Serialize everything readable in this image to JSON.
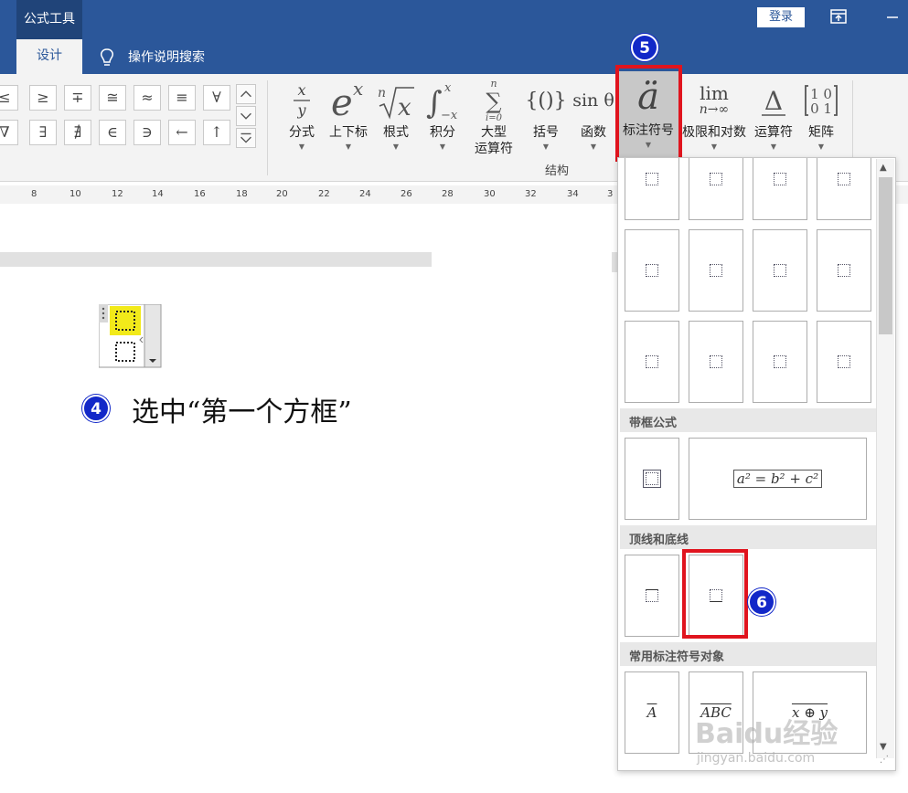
{
  "titlebar": {
    "context_tab": "公式工具",
    "login": "登录",
    "brand_color": "#2b579a"
  },
  "tabs": {
    "design": "设计",
    "search_hint": "操作说明搜索"
  },
  "symbols": {
    "row1": [
      "≤",
      "≥",
      "∓",
      "≅",
      "≈",
      "≡",
      "∀"
    ],
    "row2": [
      "∇",
      "∃",
      "∄",
      "∈",
      "∋",
      "←",
      "↑"
    ]
  },
  "ribbon": {
    "buttons": [
      {
        "label": "分式",
        "icon": "fraction-icon"
      },
      {
        "label": "上下标",
        "icon": "script-icon"
      },
      {
        "label": "根式",
        "icon": "radical-icon"
      },
      {
        "label": "积分",
        "icon": "integral-icon"
      },
      {
        "label": "大型\n运算符",
        "icon": "large-operator-icon"
      },
      {
        "label": "括号",
        "icon": "bracket-icon"
      },
      {
        "label": "函数",
        "icon": "function-icon"
      },
      {
        "label": "标注符号",
        "icon": "accent-icon"
      },
      {
        "label": "极限和对数",
        "icon": "limit-log-icon"
      },
      {
        "label": "运算符",
        "icon": "operator-icon"
      },
      {
        "label": "矩阵",
        "icon": "matrix-icon"
      }
    ],
    "group_label": "结构",
    "icons_text": {
      "large_op": "∑",
      "bracket": "{()}",
      "function": "sin θ",
      "accent": "ä",
      "limit": "lim",
      "limit_sub": "n→∞",
      "operator": "Δ",
      "matrix": "10\n01"
    }
  },
  "ruler": {
    "marks": [
      "8",
      "10",
      "12",
      "14",
      "16",
      "18",
      "20",
      "22",
      "24",
      "26",
      "28",
      "30",
      "32",
      "34",
      "3"
    ]
  },
  "annotations": {
    "step4_number": "4",
    "step4_text": "选中“第一个方框”",
    "step5_number": "5",
    "step6_number": "6",
    "highlight_color": "#e0141e",
    "badge_color": "#1228c8"
  },
  "gallery": {
    "sections": {
      "boxed": "带框公式",
      "overline_underline": "顶线和底线",
      "common_accents": "常用标注符号对象"
    },
    "boxed_formula": "a² = b² + c²",
    "common_items": [
      "A",
      "ABC",
      "x ⊕ y"
    ]
  },
  "watermark": {
    "brand": "Baidu经验",
    "url": "jingyan.baidu.com"
  }
}
